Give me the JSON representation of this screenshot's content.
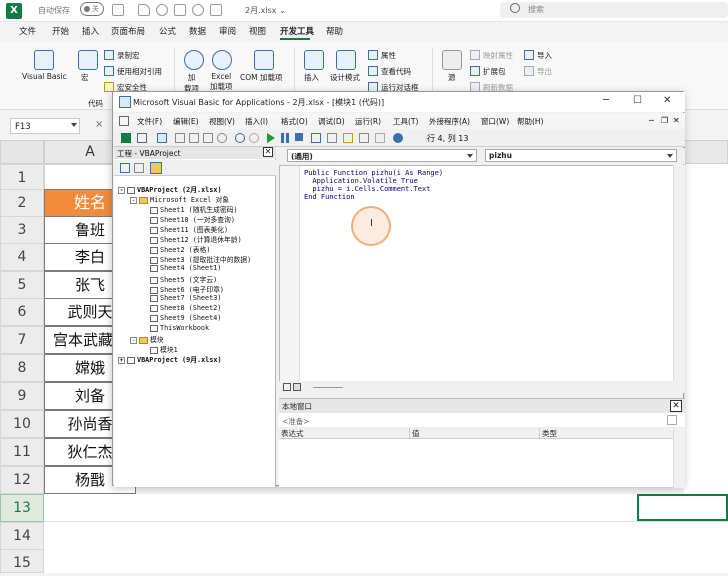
{
  "titlebar": {
    "autosave_label": "自动保存",
    "toggle_state": "关",
    "doc_title": "2月.xlsx ⌄",
    "search_placeholder": "搜索"
  },
  "tabs": [
    "文件",
    "开始",
    "插入",
    "页面布局",
    "公式",
    "数据",
    "审阅",
    "视图",
    "开发工具",
    "帮助"
  ],
  "active_tab": "开发工具",
  "ribbon": {
    "visual_basic": "Visual Basic",
    "macro": "宏",
    "record_macro": "录制宏",
    "relative_ref": "使用相对引用",
    "macro_security": "宏安全性",
    "group_code": "代码",
    "add_ins": "加\n载项",
    "excel_add_ins": "Excel\n加载项",
    "com_add_ins": "COM 加载项",
    "insert": "插入",
    "design_mode": "设计模式",
    "properties": "属性",
    "view_code": "查看代码",
    "run_dialog": "运行对话框",
    "source": "源",
    "map_props": "映射属性",
    "expansion_pack": "扩展包",
    "refresh_data": "刷新数据",
    "import": "导入",
    "export": "导出"
  },
  "formula_bar": {
    "name_box": "F13",
    "cancel": "×"
  },
  "sheet": {
    "col_header": "A",
    "rows": [
      "1",
      "2",
      "3",
      "4",
      "5",
      "6",
      "7",
      "8",
      "9",
      "10",
      "11",
      "12",
      "13",
      "14",
      "15"
    ],
    "cells": [
      "",
      "姓名",
      "鲁班",
      "李白",
      "张飞",
      "武则天",
      "宫本武藏",
      "嫦娥",
      "刘备",
      "孙尚香",
      "狄仁杰",
      "杨戬"
    ]
  },
  "vba": {
    "title": "Microsoft Visual Basic for Applications - 2月.xlsx - [模块1 (代码)]",
    "menu": [
      "文件(F)",
      "编辑(E)",
      "视图(V)",
      "插入(I)",
      "格式(O)",
      "调试(D)",
      "运行(R)",
      "工具(T)",
      "外接程序(A)",
      "窗口(W)",
      "帮助(H)"
    ],
    "position": "行 4, 列 13",
    "project_title": "工程 - VBAProject",
    "tree": [
      "VBAProject (2月.xlsx)",
      "Microsoft Excel 对象",
      "Sheet1 (随机生成密码)",
      "Sheet10 (一对多查询)",
      "Sheet11 (图表美化)",
      "Sheet12 (计算退休年龄)",
      "Sheet2 (表格)",
      "Sheet3 (提取批注中的数据)",
      "Sheet4 (Sheet1)",
      "Sheet5 (文字云)",
      "Sheet6 (电子印章)",
      "Sheet7 (Sheet3)",
      "Sheet8 (Sheet2)",
      "Sheet9 (Sheet4)",
      "ThisWorkbook",
      "模块",
      "模块1",
      "VBAProject (9月.xlsx)"
    ],
    "combo_left": "(通用)",
    "combo_right": "pizhu",
    "code": [
      "Public Function pizhu(i As Range)",
      "  Application.Volatile True",
      "  pizhu = i.Cells.Comment.Text",
      "End Function"
    ],
    "locals_title": "本地窗口",
    "locals_status": "<准备>",
    "locals_cols": [
      "表达式",
      "值",
      "类型"
    ]
  }
}
